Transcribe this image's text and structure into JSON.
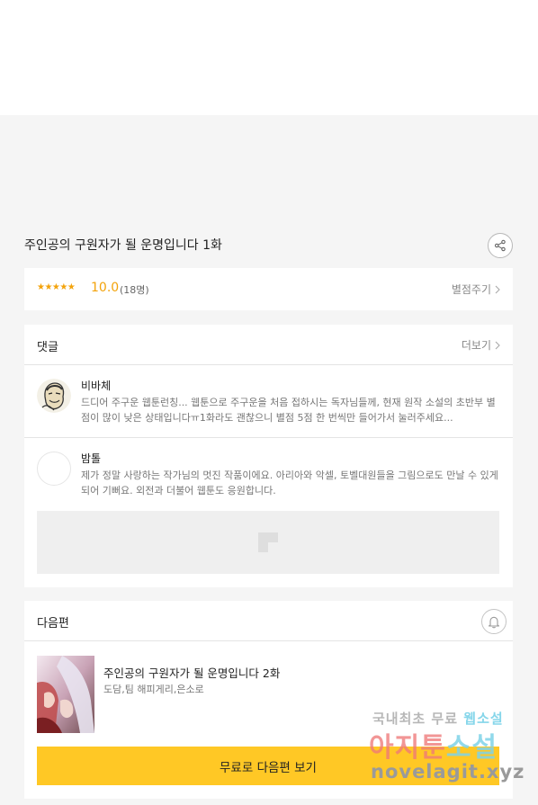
{
  "episode": {
    "title": "주인공의 구원자가 될 운명입니다 1화",
    "share_icon": "share-icon"
  },
  "rating": {
    "stars": "★★★★★",
    "score": "10.0",
    "count": "(18명)",
    "rate_label": "별점주기",
    "star_color": "#f3a30b"
  },
  "comments": {
    "header": "댓글",
    "more_label": "더보기",
    "items": [
      {
        "nickname": "비바체",
        "text": "드디어 주구운 웹툰런칭... 웹툰으로 주구운을 처음 접하시는 독자님들께, 현재 원작 소설의 초반부 별점이 많이 낮은 상태입니다ㅠ1화라도 괜찮으니 별점 5점 한 번씩만 들어가서 눌러주세요..."
      },
      {
        "nickname": "밤톨",
        "text": "제가 정말 사랑하는 작가님의 멋진 작품이에요. 아리아와 악셀, 토벨대원들을 그림으로도 만날 수 있게 되어 기뻐요. 외전과 더불어 웹툰도 응원합니다."
      }
    ]
  },
  "next_episode": {
    "header": "다음편",
    "title": "주인공의 구원자가 될 운명입니다 2화",
    "authors": "도담,팀 해피게리,은소로",
    "button_label": "무료로 다음편 보기",
    "button_color": "#ffc825"
  },
  "watermark": {
    "line1_a": "국내최초 무료",
    "line1_b": "웹소설",
    "line2_a": "아지툰",
    "line2_b": "소설",
    "line3": "novelagit.xyz"
  }
}
